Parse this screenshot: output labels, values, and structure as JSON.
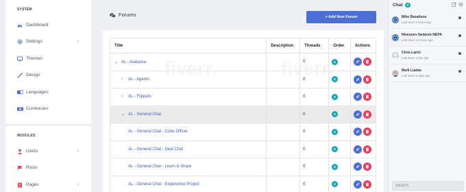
{
  "sidebar": {
    "system_heading": "SYSTEM",
    "system_items": [
      {
        "label": "Dashboard",
        "icon": "dashboard-icon",
        "color": "#4c6fd6",
        "has_chevron": false
      },
      {
        "label": "Settings",
        "icon": "gear-icon",
        "color": "#4c6fd6",
        "has_chevron": true
      },
      {
        "label": "Themes",
        "icon": "monitor-icon",
        "color": "#4c6fd6",
        "has_chevron": false
      },
      {
        "label": "Design",
        "icon": "brush-icon",
        "color": "#4c6fd6",
        "has_chevron": false
      },
      {
        "label": "Languages",
        "icon": "languages-icon",
        "color": "#4c6fd6",
        "has_chevron": false
      },
      {
        "label": "Currencies",
        "icon": "currency-icon",
        "color": "#4c6fd6",
        "has_chevron": false
      }
    ],
    "modules_heading": "MODULES",
    "module_items": [
      {
        "label": "Users",
        "icon": "user-icon",
        "color": "#e8455a",
        "has_chevron": true
      },
      {
        "label": "Posts",
        "icon": "flag-icon",
        "color": "#e8455a",
        "has_chevron": false
      },
      {
        "label": "Pages",
        "icon": "pages-icon",
        "color": "#e8455a",
        "has_chevron": true
      }
    ]
  },
  "main": {
    "title": "Forums",
    "title_icon": "comments-icon",
    "add_button_label": "+ Add New Forum",
    "table": {
      "headers": [
        "Title",
        "Description",
        "Threads",
        "Order",
        "Actions"
      ],
      "rows": [
        {
          "title": "AL - Alabama",
          "caret": "⌄",
          "level": 0,
          "threads": "0",
          "order": "0",
          "highlight": false
        },
        {
          "title": "AL - Agents",
          "caret": "›",
          "level": 1,
          "threads": "0",
          "order": "0",
          "highlight": false
        },
        {
          "title": "AL - Flippers",
          "caret": "›",
          "level": 1,
          "threads": "0",
          "order": "0",
          "highlight": false
        },
        {
          "title": "AL - General Chat",
          "caret": "⌄",
          "level": 1,
          "threads": "0",
          "order": "0",
          "highlight": true
        },
        {
          "title": "AL - General Chat - Code Officer",
          "caret": "",
          "level": 2,
          "threads": "0",
          "order": "0",
          "highlight": false
        },
        {
          "title": "AL - General Chat - Deal Chat",
          "caret": "",
          "level": 2,
          "threads": "0",
          "order": "0",
          "highlight": false
        },
        {
          "title": "AL - General Chat - Learn & Share",
          "caret": "",
          "level": 2,
          "threads": "0",
          "order": "0",
          "highlight": false
        },
        {
          "title": "AL - General Chat - Experience Project",
          "caret": "",
          "level": 2,
          "threads": "0",
          "order": "0",
          "highlight": false
        }
      ]
    }
  },
  "chat": {
    "title": "Chat",
    "count": "0",
    "search_placeholder": "Search",
    "contacts": [
      {
        "name": "Mike Bazadona",
        "seen": "Last Seen 3 hours ago",
        "avatar": "globe-avatar"
      },
      {
        "name": "INvestors Network NEPA",
        "seen": "Last Seen 14 hours ago",
        "avatar": "globe-avatar"
      },
      {
        "name": "Chris Larini",
        "seen": "Last Seen a day ago",
        "avatar": "default-avatar"
      },
      {
        "name": "Mark Liadas",
        "seen": "Last Seen 5 days ago",
        "avatar": "photo-avatar"
      }
    ]
  },
  "colors": {
    "accent": "#4c6fd6",
    "teal": "#16a8b5",
    "danger": "#ee3b5b"
  }
}
